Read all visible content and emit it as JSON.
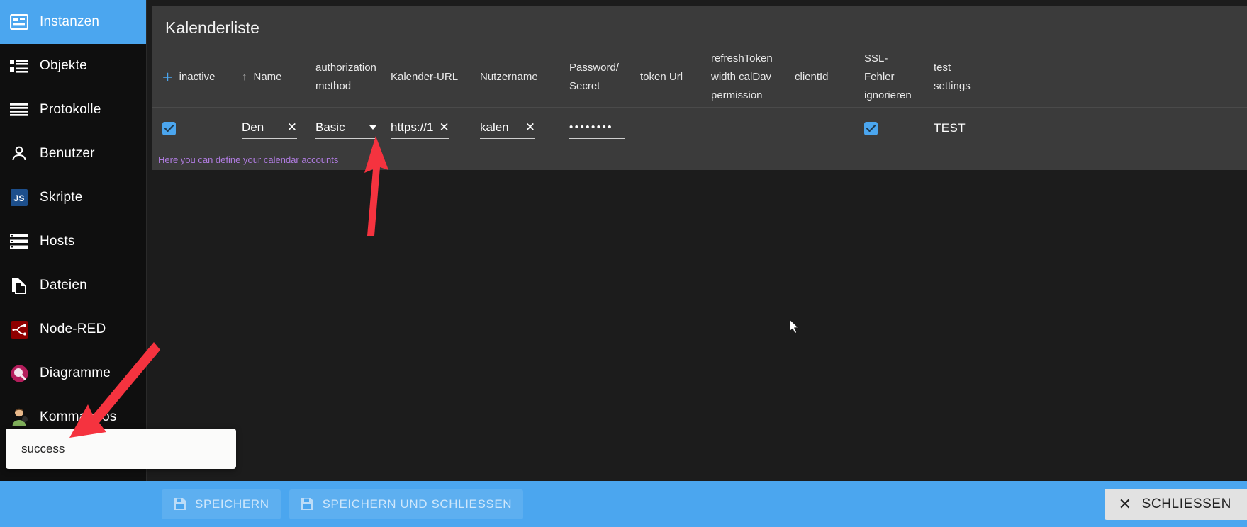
{
  "sidebar": {
    "items": [
      {
        "label": "Instanzen",
        "icon": "instances-icon",
        "active": true
      },
      {
        "label": "Objekte",
        "icon": "objects-icon",
        "active": false
      },
      {
        "label": "Protokolle",
        "icon": "logs-icon",
        "active": false
      },
      {
        "label": "Benutzer",
        "icon": "user-icon",
        "active": false
      },
      {
        "label": "Skripte",
        "icon": "javascript-icon",
        "active": false
      },
      {
        "label": "Hosts",
        "icon": "hosts-icon",
        "active": false
      },
      {
        "label": "Dateien",
        "icon": "files-icon",
        "active": false
      },
      {
        "label": "Node-RED",
        "icon": "node-red-icon",
        "active": false
      },
      {
        "label": "Diagramme",
        "icon": "charts-icon",
        "active": false
      },
      {
        "label": "Kommandos",
        "icon": "commands-icon",
        "active": false
      }
    ]
  },
  "panel": {
    "title": "Kalenderliste",
    "hint_link": "Here you can define your calendar accounts",
    "columns": [
      {
        "key": "inactive",
        "label": "inactive",
        "prefix": "add"
      },
      {
        "key": "name",
        "label": "Name",
        "prefix": "sort-asc"
      },
      {
        "key": "auth",
        "label": "authorization\nmethod"
      },
      {
        "key": "url",
        "label": "Kalender-URL"
      },
      {
        "key": "user",
        "label": "Nutzername"
      },
      {
        "key": "pass",
        "label": "Password/\nSecret"
      },
      {
        "key": "token",
        "label": "token Url"
      },
      {
        "key": "refresh",
        "label": "refreshToken\nwidth calDav\npermission"
      },
      {
        "key": "client",
        "label": "clientId"
      },
      {
        "key": "ssl",
        "label": "SSL-\nFehler\nignorieren"
      },
      {
        "key": "test",
        "label": "test\nsettings"
      }
    ],
    "rows": [
      {
        "inactive": true,
        "name": "Den",
        "auth": "Basic",
        "url": "https://1",
        "user": "kalen",
        "pass": "••••••••",
        "token": "",
        "refresh": "",
        "client": "",
        "ssl": true,
        "test": "TEST"
      }
    ]
  },
  "bottombar": {
    "save_label": "SPEICHERN",
    "save_close_label": "SPEICHERN UND SCHLIESSEN",
    "close_label": "SCHLIESSEN"
  },
  "toast": {
    "message": "success"
  },
  "colors": {
    "accent": "#4ba6ef",
    "panel_bg": "#3b3b3b",
    "page_bg": "#1c1c1c",
    "sidebar_bg": "#0f0f0f",
    "annotation": "#f5333f",
    "link": "#b07ce0"
  }
}
